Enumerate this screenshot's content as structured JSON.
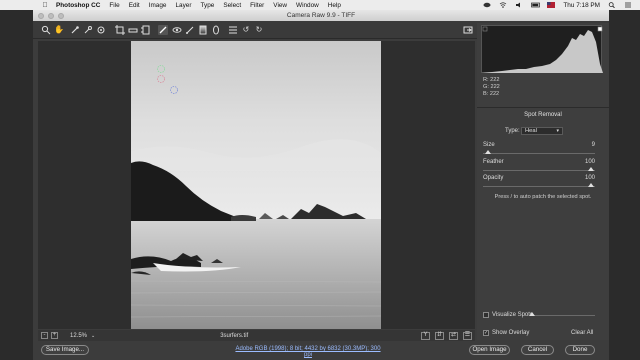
{
  "menubar": {
    "apple": "",
    "app_name": "Photoshop CC",
    "items": [
      "File",
      "Edit",
      "Image",
      "Layer",
      "Type",
      "Select",
      "Filter",
      "View",
      "Window",
      "Help"
    ],
    "time": "Thu 7:18 PM"
  },
  "dialog": {
    "title": "Camera Raw 9.9  -  TIFF",
    "file_name": "3surfers.tif",
    "zoom": "12.5%",
    "info_link": "Adobe RGB (1998); 8 bit; 4432 by 6832 (30.3MP); 300 ppi",
    "buttons": {
      "save_image": "Save Image...",
      "open_image": "Open Image",
      "cancel": "Cancel",
      "done": "Done"
    }
  },
  "panel": {
    "rgb": {
      "r": "R:   222",
      "g": "G:   222",
      "b": "B:   222"
    },
    "section_title": "Spot Removal",
    "type_label": "Type:",
    "type_value": "Heal",
    "size_label": "Size",
    "size_value": "9",
    "feather_label": "Feather",
    "feather_value": "100",
    "opacity_label": "Opacity",
    "opacity_value": "100",
    "hint": "Press / to auto patch the selected spot.",
    "visualize_label": "Visualize Spots",
    "overlay_label": "Show Overlay",
    "clear_all": "Clear All"
  },
  "icons": {
    "zoom": "zoom-icon",
    "hand": "hand-icon",
    "white_balance": "eyedropper-icon",
    "color_sampler": "color-sampler-icon",
    "target_adjust": "target-adjust-icon",
    "crop": "crop-icon",
    "straighten": "straighten-icon",
    "transform": "transform-icon",
    "spot_removal": "brush-icon"
  },
  "colors": {
    "link": "#9bbcff",
    "panel": "#3e3e3e",
    "canvas": "#2e2e2e"
  }
}
